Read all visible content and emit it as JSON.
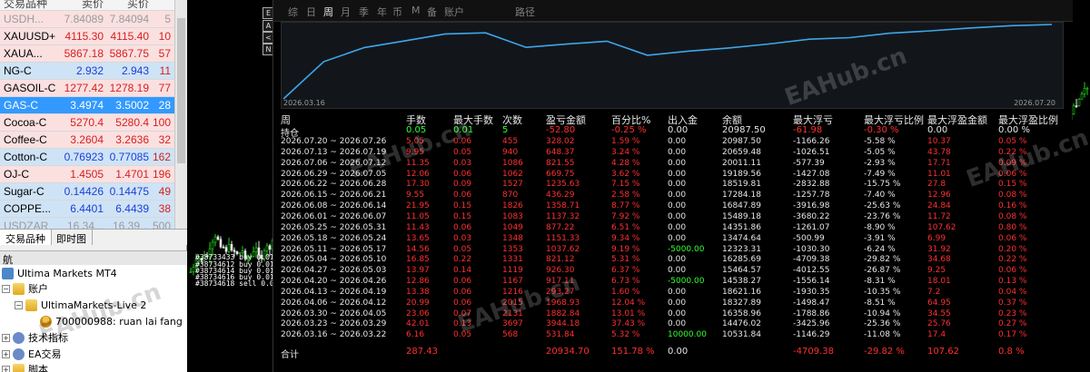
{
  "market_watch": {
    "header": [
      "交易品种",
      "卖价",
      "买价"
    ],
    "rows": [
      {
        "symbol": "USDH...",
        "bid": "7.84089",
        "ask": "7.84094",
        "spread": "5",
        "style": "pink",
        "dim": true
      },
      {
        "symbol": "XAUUSD+",
        "bid": "4115.30",
        "ask": "4115.40",
        "spread": "10",
        "style": "pink"
      },
      {
        "symbol": "XAUA...",
        "bid": "5867.18",
        "ask": "5867.75",
        "spread": "57",
        "style": "pink"
      },
      {
        "symbol": "NG-C",
        "bid": "2.932",
        "ask": "2.943",
        "spread": "11",
        "style": "blue"
      },
      {
        "symbol": "GASOIL-C",
        "bid": "1277.42",
        "ask": "1278.19",
        "spread": "77",
        "style": "pink"
      },
      {
        "symbol": "GAS-C",
        "bid": "3.4974",
        "ask": "3.5002",
        "spread": "28",
        "style": "sel"
      },
      {
        "symbol": "Cocoa-C",
        "bid": "5270.4",
        "ask": "5280.4",
        "spread": "100",
        "style": "pink"
      },
      {
        "symbol": "Coffee-C",
        "bid": "3.2604",
        "ask": "3.2636",
        "spread": "32",
        "style": "pink"
      },
      {
        "symbol": "Cotton-C",
        "bid": "0.76923",
        "ask": "0.77085",
        "spread": "162",
        "style": "blue"
      },
      {
        "symbol": "OJ-C",
        "bid": "1.4505",
        "ask": "1.4701",
        "spread": "196",
        "style": "pink"
      },
      {
        "symbol": "Sugar-C",
        "bid": "0.14426",
        "ask": "0.14475",
        "spread": "49",
        "style": "blue"
      },
      {
        "symbol": "COPPE...",
        "bid": "6.4401",
        "ask": "6.4439",
        "spread": "38",
        "style": "blue"
      },
      {
        "symbol": "USDZAR",
        "bid": "16.34...",
        "ask": "16.39...",
        "spread": "500",
        "style": "blue",
        "dim": true
      }
    ],
    "tabs": [
      "交易品种",
      "即时图"
    ]
  },
  "navigator": {
    "title": "航",
    "items": [
      {
        "label": "Ultima Markets MT4",
        "icon": "terminal-icon"
      },
      {
        "label": "账户",
        "icon": "folder-icon"
      },
      {
        "label": "UltimaMarkets-Live 2",
        "icon": "server-icon"
      },
      {
        "label": "700000988: ruan lai fang",
        "icon": "user-icon"
      },
      {
        "label": "技术指标",
        "icon": "indicator-icon"
      },
      {
        "label": "EA交易",
        "icon": "ea-icon"
      },
      {
        "label": "脚本",
        "icon": "script-icon"
      }
    ]
  },
  "chart": {
    "orders": [
      "#38733433 buy 0.01",
      "#38734612 buy 0.01",
      "#38734614 buy 0.01",
      "#38734616 buy 0.01",
      "#38734618 sell 0.01"
    ],
    "side_buttons": [
      "E",
      "A",
      "<",
      "N"
    ]
  },
  "report": {
    "tabs": [
      "综",
      "日",
      "周",
      "月",
      "季",
      "年",
      "币",
      "M",
      "备",
      "账户",
      "路径"
    ],
    "active_tab": "周",
    "curve": {
      "start_label": "2026.03.16",
      "end_label": "2026.07.20",
      "color": "#3fa6e8"
    },
    "columns": [
      "周",
      "手数",
      "最大手数",
      "次数",
      "盈亏金额",
      "百分比%",
      "出入金",
      "余额",
      "最大浮亏",
      "最大浮亏比例",
      "最大浮盈金额",
      "最大浮盈比例"
    ],
    "holding": {
      "label": "持仓",
      "lots": "0.05",
      "max_lots": "0.01",
      "count": "5",
      "pnl": "-52.80",
      "pct": "-0.25 %",
      "deposit": "0.00",
      "balance": "20987.50",
      "max_dd": "-61.98",
      "max_dd_pct": "-0.30 %",
      "max_fp": "0.00",
      "max_fp_pct": "0.00 %"
    },
    "rows": [
      {
        "week": "2026.07.20 ~ 2026.07.26",
        "lots": "5.05",
        "max_lots": "0.06",
        "count": "455",
        "pnl": "328.02",
        "pct": "1.59 %",
        "deposit": "0.00",
        "balance": "20987.50",
        "max_dd": "-1166.26",
        "max_dd_pct": "-5.58 %",
        "max_fp": "10.37",
        "max_fp_pct": "0.05 %"
      },
      {
        "week": "2026.07.13 ~ 2026.07.19",
        "lots": "9.95",
        "max_lots": "0.05",
        "count": "940",
        "pnl": "648.37",
        "pct": "3.24 %",
        "deposit": "0.00",
        "balance": "20659.48",
        "max_dd": "-1026.51",
        "max_dd_pct": "-5.05 %",
        "max_fp": "43.78",
        "max_fp_pct": "0.22 %"
      },
      {
        "week": "2026.07.06 ~ 2026.07.12",
        "lots": "11.35",
        "max_lots": "0.03",
        "count": "1086",
        "pnl": "821.55",
        "pct": "4.28 %",
        "deposit": "0.00",
        "balance": "20011.11",
        "max_dd": "-577.39",
        "max_dd_pct": "-2.93 %",
        "max_fp": "17.71",
        "max_fp_pct": "0.09 %"
      },
      {
        "week": "2026.06.29 ~ 2026.07.05",
        "lots": "12.06",
        "max_lots": "0.06",
        "count": "1062",
        "pnl": "669.75",
        "pct": "3.62 %",
        "deposit": "0.00",
        "balance": "19189.56",
        "max_dd": "-1427.08",
        "max_dd_pct": "-7.49 %",
        "max_fp": "11.01",
        "max_fp_pct": "0.06 %"
      },
      {
        "week": "2026.06.22 ~ 2026.06.28",
        "lots": "17.30",
        "max_lots": "0.09",
        "count": "1527",
        "pnl": "1235.63",
        "pct": "7.15 %",
        "deposit": "0.00",
        "balance": "18519.81",
        "max_dd": "-2832.88",
        "max_dd_pct": "-15.75 %",
        "max_fp": "27.8",
        "max_fp_pct": "0.15 %"
      },
      {
        "week": "2026.06.15 ~ 2026.06.21",
        "lots": "9.55",
        "max_lots": "0.06",
        "count": "870",
        "pnl": "436.29",
        "pct": "2.58 %",
        "deposit": "0.00",
        "balance": "17284.18",
        "max_dd": "-1257.78",
        "max_dd_pct": "-7.40 %",
        "max_fp": "12.96",
        "max_fp_pct": "0.08 %"
      },
      {
        "week": "2026.06.08 ~ 2026.06.14",
        "lots": "21.95",
        "max_lots": "0.15",
        "count": "1826",
        "pnl": "1358.71",
        "pct": "8.77 %",
        "deposit": "0.00",
        "balance": "16847.89",
        "max_dd": "-3916.98",
        "max_dd_pct": "-25.63 %",
        "max_fp": "24.84",
        "max_fp_pct": "0.16 %"
      },
      {
        "week": "2026.06.01 ~ 2026.06.07",
        "lots": "11.05",
        "max_lots": "0.15",
        "count": "1083",
        "pnl": "1137.32",
        "pct": "7.92 %",
        "deposit": "0.00",
        "balance": "15489.18",
        "max_dd": "-3680.22",
        "max_dd_pct": "-23.76 %",
        "max_fp": "11.72",
        "max_fp_pct": "0.08 %"
      },
      {
        "week": "2026.05.25 ~ 2026.05.31",
        "lots": "11.43",
        "max_lots": "0.06",
        "count": "1049",
        "pnl": "877.22",
        "pct": "6.51 %",
        "deposit": "0.00",
        "balance": "14351.86",
        "max_dd": "-1261.07",
        "max_dd_pct": "-8.90 %",
        "max_fp": "107.62",
        "max_fp_pct": "0.80 %"
      },
      {
        "week": "2026.05.18 ~ 2026.05.24",
        "lots": "13.65",
        "max_lots": "0.03",
        "count": "1348",
        "pnl": "1151.33",
        "pct": "9.34 %",
        "deposit": "0.00",
        "balance": "13474.64",
        "max_dd": "-500.99",
        "max_dd_pct": "-3.91 %",
        "max_fp": "6.99",
        "max_fp_pct": "0.06 %"
      },
      {
        "week": "2026.05.11 ~ 2026.05.17",
        "lots": "14.56",
        "max_lots": "0.05",
        "count": "1353",
        "pnl": "1037.62",
        "pct": "9.19 %",
        "deposit": "-5000.00",
        "balance": "12323.31",
        "max_dd": "-1030.30",
        "max_dd_pct": "-6.24 %",
        "max_fp": "31.92",
        "max_fp_pct": "0.20 %"
      },
      {
        "week": "2026.05.04 ~ 2026.05.10",
        "lots": "16.85",
        "max_lots": "0.22",
        "count": "1331",
        "pnl": "821.12",
        "pct": "5.31 %",
        "deposit": "0.00",
        "balance": "16285.69",
        "max_dd": "-4709.38",
        "max_dd_pct": "-29.82 %",
        "max_fp": "34.68",
        "max_fp_pct": "0.22 %"
      },
      {
        "week": "2026.04.27 ~ 2026.05.03",
        "lots": "13.97",
        "max_lots": "0.14",
        "count": "1119",
        "pnl": "926.30",
        "pct": "6.37 %",
        "deposit": "0.00",
        "balance": "15464.57",
        "max_dd": "-4012.55",
        "max_dd_pct": "-26.87 %",
        "max_fp": "9.25",
        "max_fp_pct": "0.06 %"
      },
      {
        "week": "2026.04.20 ~ 2026.04.26",
        "lots": "12.86",
        "max_lots": "0.06",
        "count": "1167",
        "pnl": "917.11",
        "pct": "6.73 %",
        "deposit": "-5000.00",
        "balance": "14538.27",
        "max_dd": "-1556.14",
        "max_dd_pct": "-8.31 %",
        "max_fp": "18.01",
        "max_fp_pct": "0.13 %"
      },
      {
        "week": "2026.04.13 ~ 2026.04.19",
        "lots": "13.38",
        "max_lots": "0.06",
        "count": "1216",
        "pnl": "293.27",
        "pct": "1.60 %",
        "deposit": "0.00",
        "balance": "18621.16",
        "max_dd": "-1930.35",
        "max_dd_pct": "-10.35 %",
        "max_fp": "7.2",
        "max_fp_pct": "0.04 %"
      },
      {
        "week": "2026.04.06 ~ 2026.04.12",
        "lots": "20.99",
        "max_lots": "0.06",
        "count": "2015",
        "pnl": "1968.93",
        "pct": "12.04 %",
        "deposit": "0.00",
        "balance": "18327.89",
        "max_dd": "-1498.47",
        "max_dd_pct": "-8.51 %",
        "max_fp": "64.95",
        "max_fp_pct": "0.37 %"
      },
      {
        "week": "2026.03.30 ~ 2026.04.05",
        "lots": "23.06",
        "max_lots": "0.07",
        "count": "2131",
        "pnl": "1882.84",
        "pct": "13.01 %",
        "deposit": "0.00",
        "balance": "16358.96",
        "max_dd": "-1788.86",
        "max_dd_pct": "-10.94 %",
        "max_fp": "34.55",
        "max_fp_pct": "0.23 %"
      },
      {
        "week": "2026.03.23 ~ 2026.03.29",
        "lots": "42.01",
        "max_lots": "0.13",
        "count": "3697",
        "pnl": "3944.18",
        "pct": "37.43 %",
        "deposit": "0.00",
        "balance": "14476.02",
        "max_dd": "-3425.96",
        "max_dd_pct": "-25.36 %",
        "max_fp": "25.76",
        "max_fp_pct": "0.27 %"
      },
      {
        "week": "2026.03.16 ~ 2026.03.22",
        "lots": "6.16",
        "max_lots": "0.05",
        "count": "568",
        "pnl": "531.84",
        "pct": "5.32 %",
        "deposit": "10000.00",
        "balance": "10531.84",
        "max_dd": "-1146.29",
        "max_dd_pct": "-11.08 %",
        "max_fp": "17.4",
        "max_fp_pct": "0.17 %"
      }
    ],
    "total": {
      "label": "合计",
      "lots": "287.43",
      "pnl": "20934.70",
      "pct": "151.78 %",
      "deposit": "0.00",
      "max_dd": "-4709.38",
      "max_dd_pct": "-29.82 %",
      "max_fp": "107.62",
      "max_fp_pct": "0.8 %"
    }
  },
  "watermark": "EAHub.cn"
}
